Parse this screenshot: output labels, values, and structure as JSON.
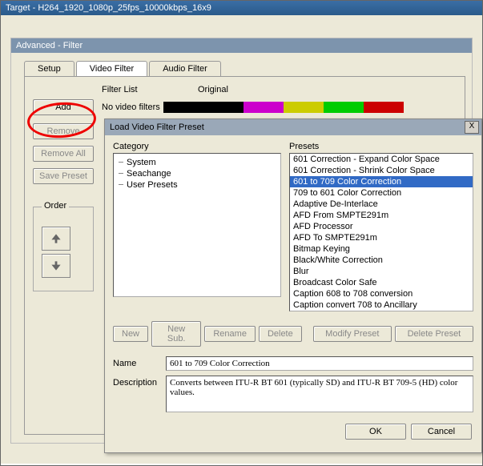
{
  "mainTitle": "Target - H264_1920_1080p_25fps_10000kbps_16x9",
  "advTitle": "Advanced - Filter",
  "tabs": {
    "setup": "Setup",
    "video": "Video Filter",
    "audio": "Audio Filter"
  },
  "labels": {
    "filterList": "Filter List",
    "original": "Original",
    "noFilters": "No video filters",
    "order": "Order"
  },
  "buttons": {
    "add": "Add",
    "remove": "Remove",
    "removeAll": "Remove All",
    "savePreset": "Save Preset"
  },
  "dlg": {
    "title": "Load Video Filter Preset",
    "close": "X",
    "category": "Category",
    "presets": "Presets",
    "catItems": [
      "System",
      "Seachange",
      "User Presets"
    ],
    "presetItems": [
      "601 Correction - Expand Color Space",
      "601 Correction - Shrink Color Space",
      "601 to 709 Color Correction",
      "709 to 601 Color Correction",
      "Adaptive De-Interlace",
      "AFD From SMPTE291m",
      "AFD Processor",
      "AFD To SMPTE291m",
      "Bitmap Keying",
      "Black/White Correction",
      "Blur",
      "Broadcast Color Safe",
      "Caption 608 to 708 conversion",
      "Caption convert 708 to Ancillary"
    ],
    "selectedIndex": 2,
    "btns": {
      "new": "New",
      "newSub": "New Sub.",
      "rename": "Rename",
      "delete": "Delete",
      "modify": "Modify Preset",
      "deletePreset": "Delete Preset"
    },
    "nameLbl": "Name",
    "descLbl": "Description",
    "nameVal": "601 to 709 Color Correction",
    "descVal": "Converts between ITU-R BT 601 (typically SD) and ITU-R BT 709-5 (HD) color values.",
    "ok": "OK",
    "cancel": "Cancel"
  }
}
